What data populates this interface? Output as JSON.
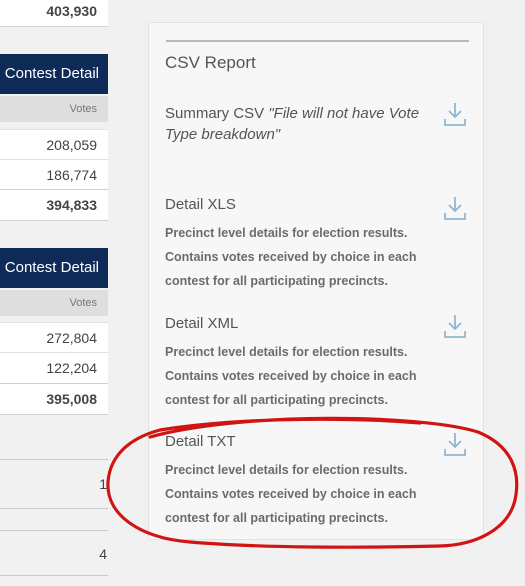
{
  "left": {
    "top_total": "403,930",
    "contest1": {
      "header": "Contest Detail",
      "votes_label": "Votes",
      "values": [
        "208,059",
        "186,774"
      ],
      "total": "394,833"
    },
    "contest2": {
      "header": "Contest Detail",
      "votes_label": "Votes",
      "values": [
        "272,804",
        "122,204"
      ],
      "total": "395,008"
    },
    "trunc1": "1",
    "trunc2": "4"
  },
  "panel": {
    "title": "CSV Report",
    "items": [
      {
        "title": "Summary CSV",
        "note": "\"File will not have Vote Type breakdown\"",
        "desc": []
      },
      {
        "title": "Detail XLS",
        "desc": [
          "Precinct level details for election results.",
          "Contains votes received by choice in each",
          "contest for all participating precincts."
        ]
      },
      {
        "title": "Detail XML",
        "desc": [
          "Precinct level details for election results.",
          "Contains votes received by choice in each",
          "contest for all participating precincts."
        ]
      },
      {
        "title": "Detail TXT",
        "desc": [
          "Precinct level details for election results.",
          "Contains votes received by choice in each",
          "contest for all participating precincts."
        ]
      }
    ]
  },
  "icons": {
    "download": "download-icon"
  },
  "colors": {
    "header_bg": "#0e2a57",
    "icon": "#8fb8cf",
    "annotation": "#d01414"
  }
}
